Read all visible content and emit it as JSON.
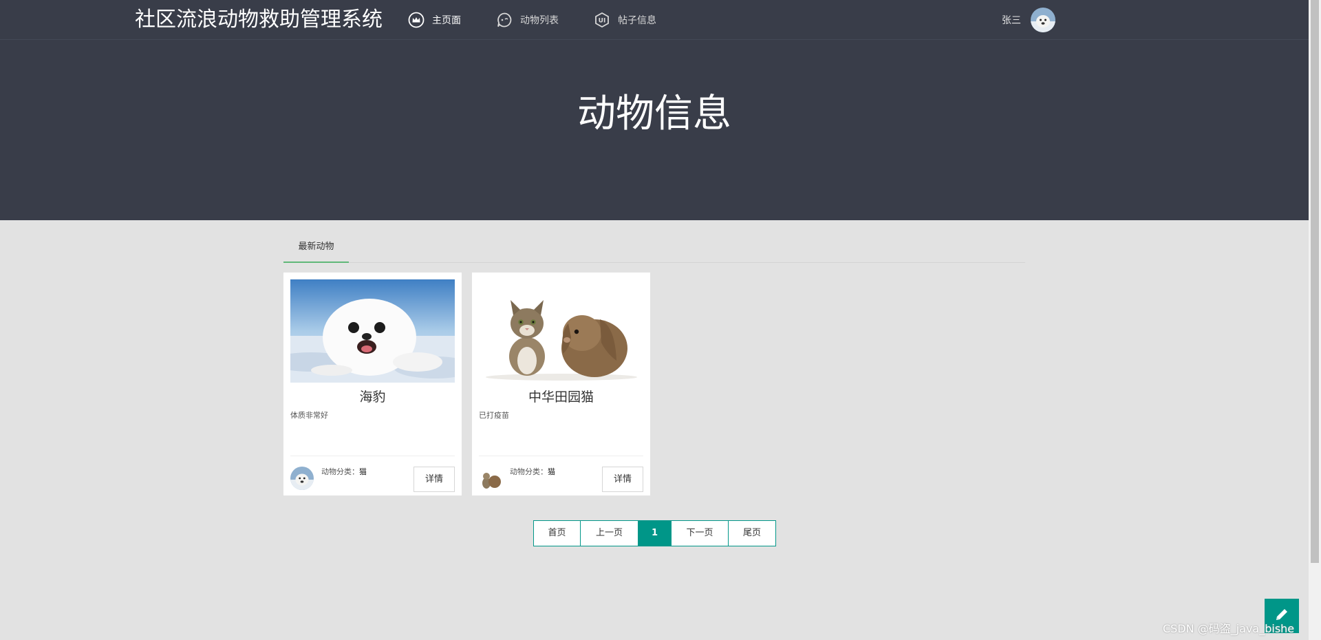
{
  "header": {
    "brand": "社区流浪动物救助管理系统",
    "nav": [
      {
        "label": "主页面",
        "icon": "crown-icon"
      },
      {
        "label": "动物列表",
        "icon": "chat-bubble-icon"
      },
      {
        "label": "帖子信息",
        "icon": "ui-shield-icon"
      }
    ],
    "username": "张三"
  },
  "banner": {
    "title": "动物信息"
  },
  "tabs": {
    "active": "最新动物"
  },
  "cards": [
    {
      "name": "海豹",
      "desc": "体质非常好",
      "category_label": "动物分类：",
      "category": "猫",
      "detail": "详情"
    },
    {
      "name": "中华田园猫",
      "desc": "已打疫苗",
      "category_label": "动物分类：",
      "category": "猫",
      "detail": "详情"
    }
  ],
  "pagination": {
    "first": "首页",
    "prev": "上一页",
    "current": "1",
    "next": "下一页",
    "last": "尾页"
  },
  "watermark": "CSDN @码盗_java_bishe",
  "colors": {
    "header_bg": "#393d49",
    "accent": "#009688",
    "tab_underline": "#5fb878",
    "page_bg": "#e2e2e2"
  }
}
